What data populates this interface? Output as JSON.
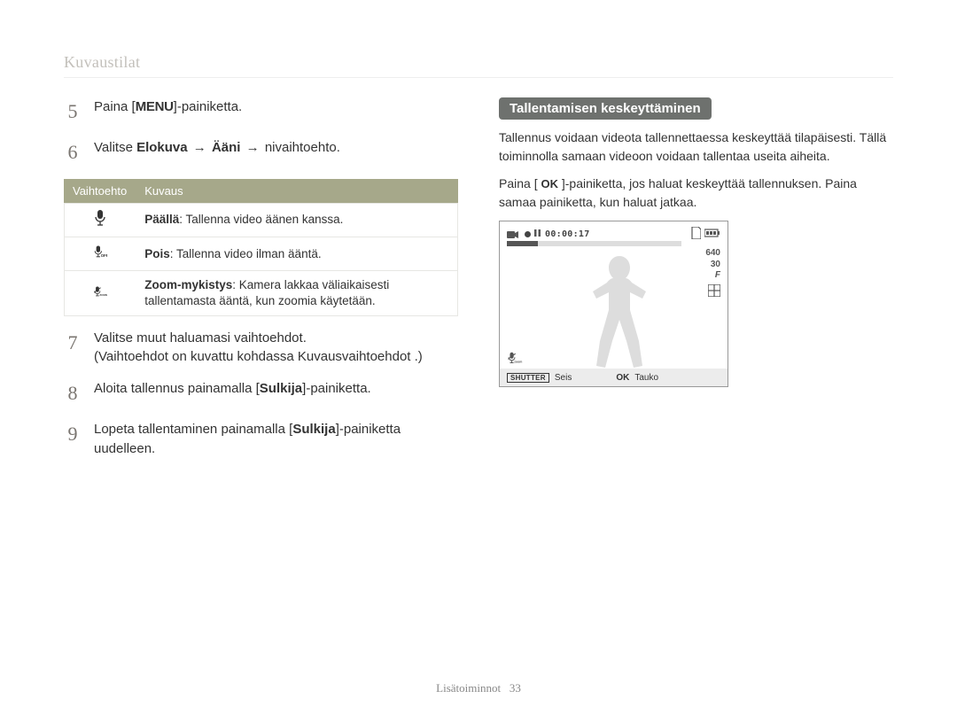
{
  "breadcrumb": "Kuvaustilat",
  "steps": {
    "s5": {
      "num": "5",
      "pre": "Paina [",
      "menu": "MENU",
      "post": "]-painiketta."
    },
    "s6": {
      "num": "6",
      "pre": "Valitse ",
      "b1": "Elokuva",
      "arrow1": " → ",
      "b2": "Ääni",
      "arrow2": " → ",
      "post": " nivaihtoehto."
    },
    "s7": {
      "num": "7",
      "line1": "Valitse muut haluamasi vaihtoehdot.",
      "line2": "(Vaihtoehdot on kuvattu kohdassa  Kuvausvaihtoehdot .)"
    },
    "s8": {
      "num": "8",
      "pre": "Aloita tallennus painamalla [",
      "b": "Sulkija",
      "post": "]-painiketta."
    },
    "s9": {
      "num": "9",
      "pre": "Lopeta tallentaminen painamalla [",
      "b": "Sulkija",
      "post": "]-painiketta uudelleen."
    }
  },
  "options_table": {
    "headers": {
      "col1": "Vaihtoehto",
      "col2": "Kuvaus"
    },
    "rows": [
      {
        "icon": "mic-on",
        "bold": "Päällä",
        "text": ": Tallenna video äänen kanssa."
      },
      {
        "icon": "mic-off",
        "bold": "Pois",
        "text": ": Tallenna video ilman ääntä."
      },
      {
        "icon": "mic-zoom",
        "bold": "Zoom-mykistys",
        "text": ": Kamera lakkaa väliaikaisesti tallentamasta ääntä, kun zoomia käytetään."
      }
    ]
  },
  "right": {
    "pill": "Tallentamisen keskeyttäminen",
    "para1": "Tallennus voidaan videota tallennettaessa keskeyttää tilapäisesti. Tällä toiminnolla samaan videoon voidaan tallentaa useita aiheita.",
    "para2_pre": "Paina [ ",
    "para2_ok": "OK",
    "para2_post": " ]-painiketta, jos haluat keskeyttää tallennuksen. Paina samaa painiketta, kun haluat jatkaa."
  },
  "display": {
    "rec_time": "00:00:17",
    "resolution": "640",
    "fps": "30",
    "fps_unit": "F",
    "shutter_label": "SHUTTER",
    "stop_label": "Seis",
    "ok_label": "OK",
    "pause_label": "Tauko"
  },
  "footer": {
    "section": "Lisätoiminnot",
    "page": "33"
  }
}
